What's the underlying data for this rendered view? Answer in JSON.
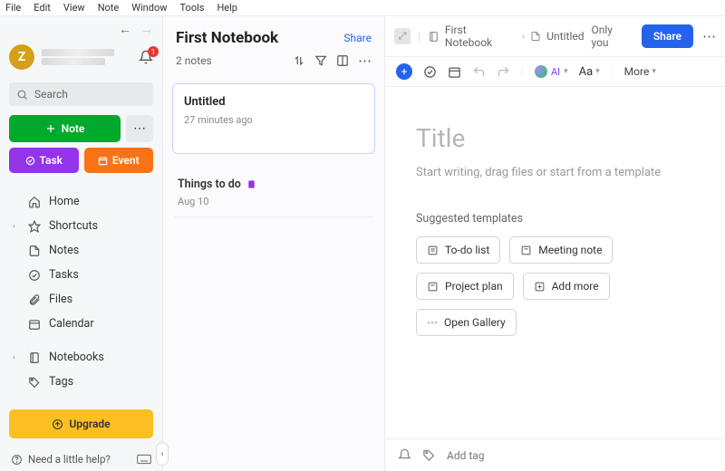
{
  "menubar": [
    "File",
    "Edit",
    "View",
    "Note",
    "Window",
    "Tools",
    "Help"
  ],
  "sidebar": {
    "avatar_initial": "Z",
    "bell_count": "1",
    "search_placeholder": "Search",
    "note_btn": "Note",
    "task_btn": "Task",
    "event_btn": "Event",
    "nav": {
      "home": "Home",
      "shortcuts": "Shortcuts",
      "notes": "Notes",
      "tasks": "Tasks",
      "files": "Files",
      "calendar": "Calendar",
      "notebooks": "Notebooks",
      "tags": "Tags"
    },
    "upgrade": "Upgrade",
    "help": "Need a little help?"
  },
  "notelist": {
    "title": "First Notebook",
    "share": "Share",
    "count": "2 notes",
    "items": [
      {
        "title": "Untitled",
        "time": "27 minutes ago"
      },
      {
        "title": "Things to do",
        "time": "Aug 10"
      }
    ]
  },
  "editor": {
    "crumb_notebook": "First Notebook",
    "crumb_note": "Untitled",
    "only_you": "Only you",
    "share": "Share",
    "toolbar": {
      "ai": "AI",
      "aa": "Aa",
      "more": "More"
    },
    "title_placeholder": "Title",
    "body_placeholder": "Start writing, drag files or start from a template",
    "suggested_label": "Suggested templates",
    "templates": [
      "To-do list",
      "Meeting note",
      "Project plan",
      "Add more",
      "Open Gallery"
    ],
    "add_tag": "Add tag"
  }
}
